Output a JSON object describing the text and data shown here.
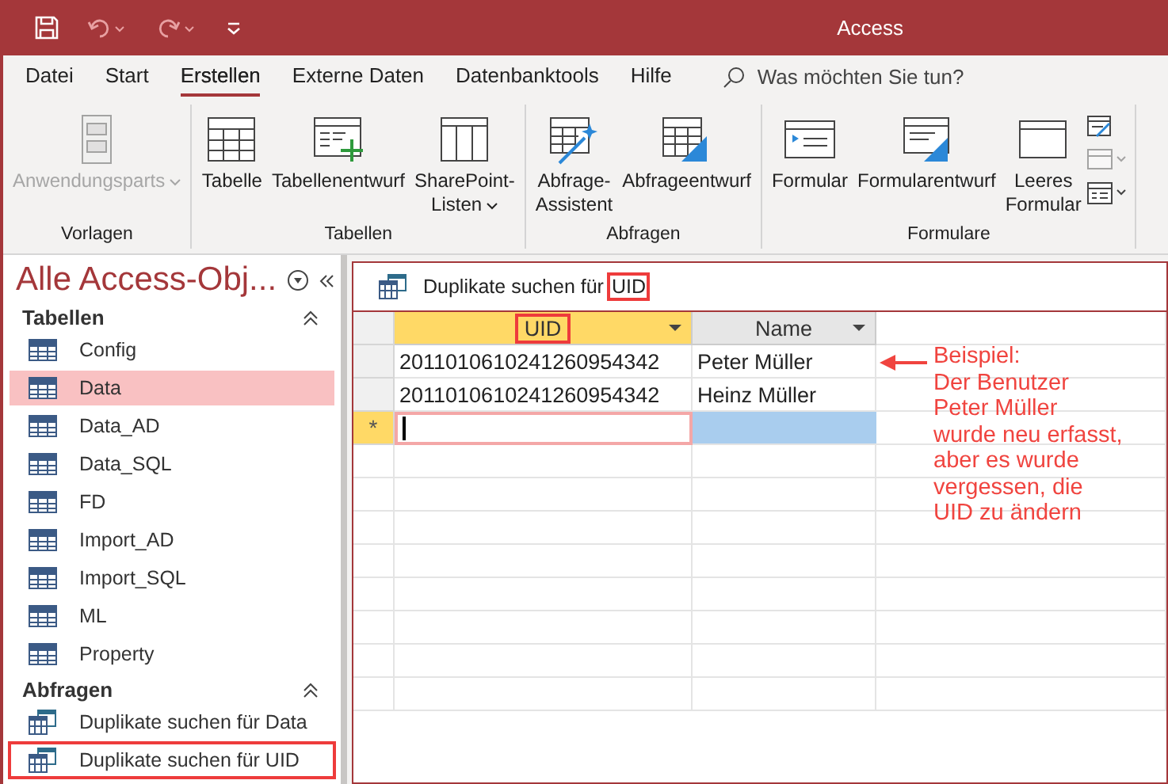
{
  "title_bar": {
    "title": "Access"
  },
  "menu_tabs": [
    {
      "label": "Datei",
      "selected": false
    },
    {
      "label": "Start",
      "selected": false
    },
    {
      "label": "Erstellen",
      "selected": true
    },
    {
      "label": "Externe Daten",
      "selected": false
    },
    {
      "label": "Datenbanktools",
      "selected": false
    },
    {
      "label": "Hilfe",
      "selected": false
    }
  ],
  "search": {
    "placeholder": "Was möchten Sie tun?"
  },
  "ribbon_groups": [
    {
      "label": "Vorlagen",
      "buttons": [
        {
          "label": "Anwendungsparts",
          "disabled": true,
          "dropdown": true
        }
      ]
    },
    {
      "label": "Tabellen",
      "buttons": [
        {
          "label": "Tabelle",
          "disabled": false,
          "dropdown": false
        },
        {
          "label": "Tabellenentwurf",
          "disabled": false,
          "dropdown": false
        },
        {
          "label": "SharePoint-Listen",
          "disabled": false,
          "dropdown": true
        }
      ]
    },
    {
      "label": "Abfragen",
      "buttons": [
        {
          "label": "Abfrage-Assistent",
          "disabled": false,
          "dropdown": false
        },
        {
          "label": "Abfrageentwurf",
          "disabled": false,
          "dropdown": false
        }
      ]
    },
    {
      "label": "Formulare",
      "buttons": [
        {
          "label": "Formular",
          "disabled": false,
          "dropdown": false
        },
        {
          "label": "Formularentwurf",
          "disabled": false,
          "dropdown": false
        },
        {
          "label": "Leeres Formular",
          "disabled": false,
          "dropdown": false
        }
      ]
    }
  ],
  "navigation": {
    "title": "Alle Access-Obj...",
    "sections": [
      {
        "label": "Tabellen",
        "kind": "table",
        "items": [
          {
            "label": "Config",
            "selected": false,
            "highlighted": false
          },
          {
            "label": "Data",
            "selected": true,
            "highlighted": false
          },
          {
            "label": "Data_AD",
            "selected": false,
            "highlighted": false
          },
          {
            "label": "Data_SQL",
            "selected": false,
            "highlighted": false
          },
          {
            "label": "FD",
            "selected": false,
            "highlighted": false
          },
          {
            "label": "Import_AD",
            "selected": false,
            "highlighted": false
          },
          {
            "label": "Import_SQL",
            "selected": false,
            "highlighted": false
          },
          {
            "label": "ML",
            "selected": false,
            "highlighted": false
          },
          {
            "label": "Property",
            "selected": false,
            "highlighted": false
          }
        ]
      },
      {
        "label": "Abfragen",
        "kind": "query",
        "items": [
          {
            "label": "Duplikate suchen für Data",
            "selected": false,
            "highlighted": false
          },
          {
            "label": "Duplikate suchen für UID",
            "selected": false,
            "highlighted": true
          }
        ]
      }
    ]
  },
  "document": {
    "title": "Duplikate suchen für",
    "title_highlight": "UID",
    "columns": [
      {
        "label": "UID",
        "selected": true,
        "highlighted": true
      },
      {
        "label": "Name",
        "selected": false,
        "highlighted": false
      }
    ],
    "rows": [
      [
        "2011010610241260954342",
        "Peter Müller"
      ],
      [
        "2011010610241260954342",
        "Heinz Müller"
      ]
    ],
    "new_row_marker": "*",
    "annotation": [
      "Beispiel:",
      "Der Benutzer",
      "Peter Müller",
      "wurde neu erfasst,",
      "aber es wurde",
      "vergessen, die",
      "UID zu ändern"
    ]
  }
}
